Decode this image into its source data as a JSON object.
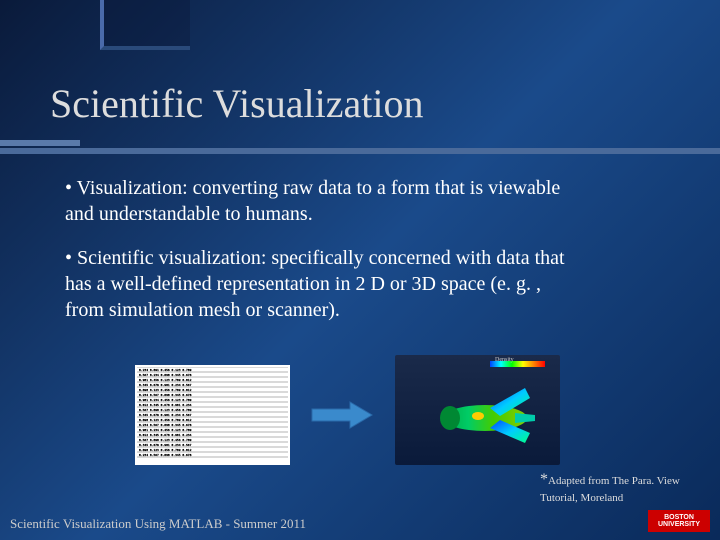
{
  "title": "Scientific Visualization",
  "bullets": {
    "first": "• Visualization: converting raw data to a form that is viewable and understandable to humans.",
    "second": "• Scientific visualization: specifically concerned with data that has a well-defined representation in 2 D or 3D space (e. g. , from simulation mesh or scanner)."
  },
  "credit": {
    "line1": "Adapted from The Para. View",
    "line2": "Tutorial, Moreland"
  },
  "footer": "Scientific Visualization Using MATLAB - Summer 2011",
  "logo": {
    "line1": "BOSTON",
    "line2": "UNIVERSITY"
  },
  "viz": {
    "label": "Density"
  }
}
